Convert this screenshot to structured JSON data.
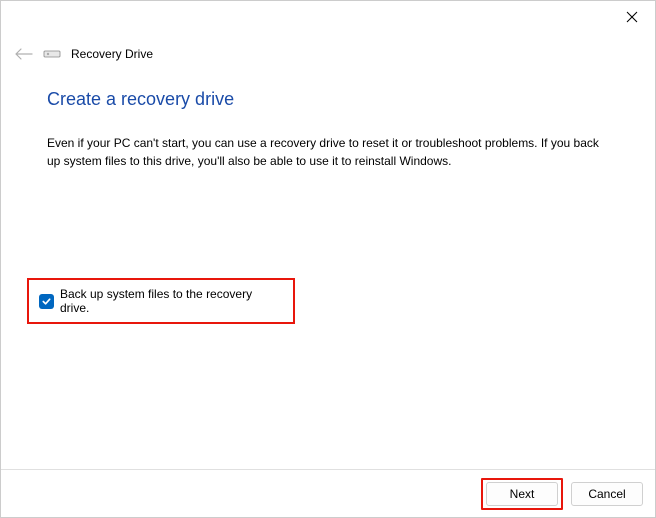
{
  "window": {
    "title": "Recovery Drive"
  },
  "content": {
    "heading": "Create a recovery drive",
    "description": "Even if your PC can't start, you can use a recovery drive to reset it or troubleshoot problems. If you back up system files to this drive, you'll also be able to use it to reinstall Windows."
  },
  "checkbox": {
    "label": "Back up system files to the recovery drive.",
    "checked": true
  },
  "buttons": {
    "next": "Next",
    "cancel": "Cancel"
  }
}
